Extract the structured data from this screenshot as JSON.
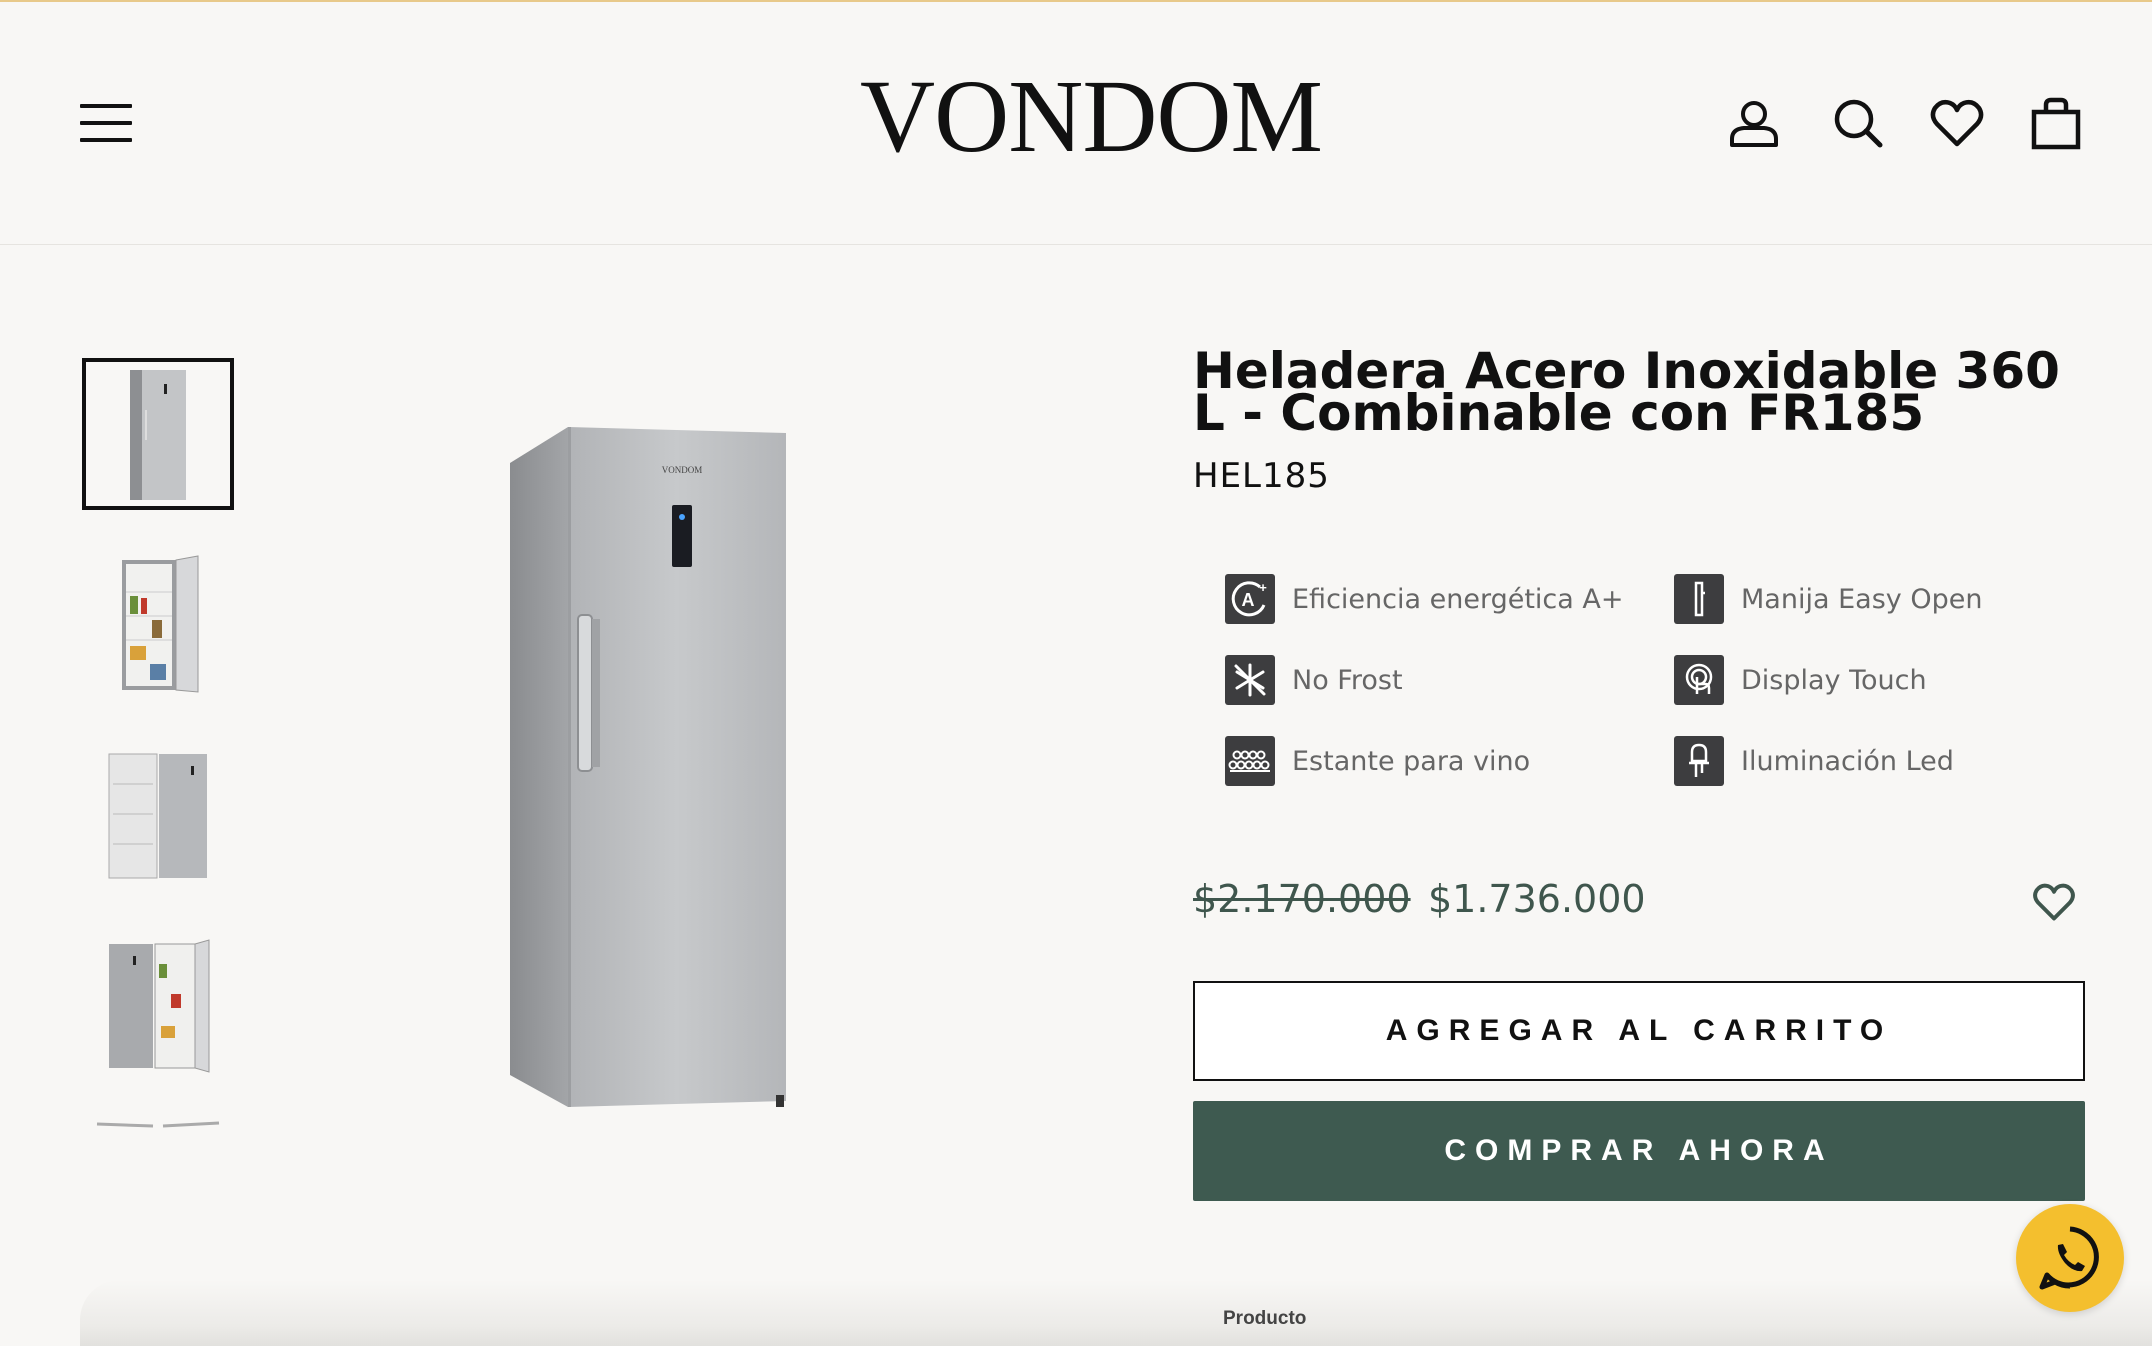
{
  "header": {
    "logo_text": "VONDOM",
    "icons": [
      "menu-icon",
      "account-icon",
      "search-icon",
      "wishlist-heart-icon",
      "cart-bag-icon"
    ]
  },
  "gallery": {
    "thumbnails": [
      "refrigerator-closed",
      "refrigerator-open-shelves",
      "refrigerator-side-by-side",
      "refrigerator-side-by-side-open",
      "refrigerator-partial"
    ],
    "active_index": 0,
    "main_image_brand_label": "VONDOM"
  },
  "product": {
    "title": "Heladera Acero Inoxidable 360 L - Combinable con FR185",
    "sku": "HEL185",
    "features": [
      {
        "icon": "energy-a-plus-icon",
        "label": "Eficiencia energética A+"
      },
      {
        "icon": "easy-open-handle-icon",
        "label": "Manija Easy Open"
      },
      {
        "icon": "no-frost-snowflake-icon",
        "label": "No Frost"
      },
      {
        "icon": "touch-display-icon",
        "label": "Display Touch"
      },
      {
        "icon": "wine-rack-icon",
        "label": "Estante para vino"
      },
      {
        "icon": "led-light-icon",
        "label": "Iluminación Led"
      }
    ],
    "price_old": "$2.170.000",
    "price_new": "$1.736.000"
  },
  "actions": {
    "add_to_cart": "AGREGAR AL CARRITO",
    "buy_now": "COMPRAR AHORA"
  },
  "footer_tab_label": "Producto",
  "colors": {
    "background": "#f8f7f5",
    "accent_green": "#3e5a50",
    "price_green": "#3f564d",
    "whatsapp_yellow": "#f4bf2e",
    "icon_dark": "#3d3d3f"
  }
}
